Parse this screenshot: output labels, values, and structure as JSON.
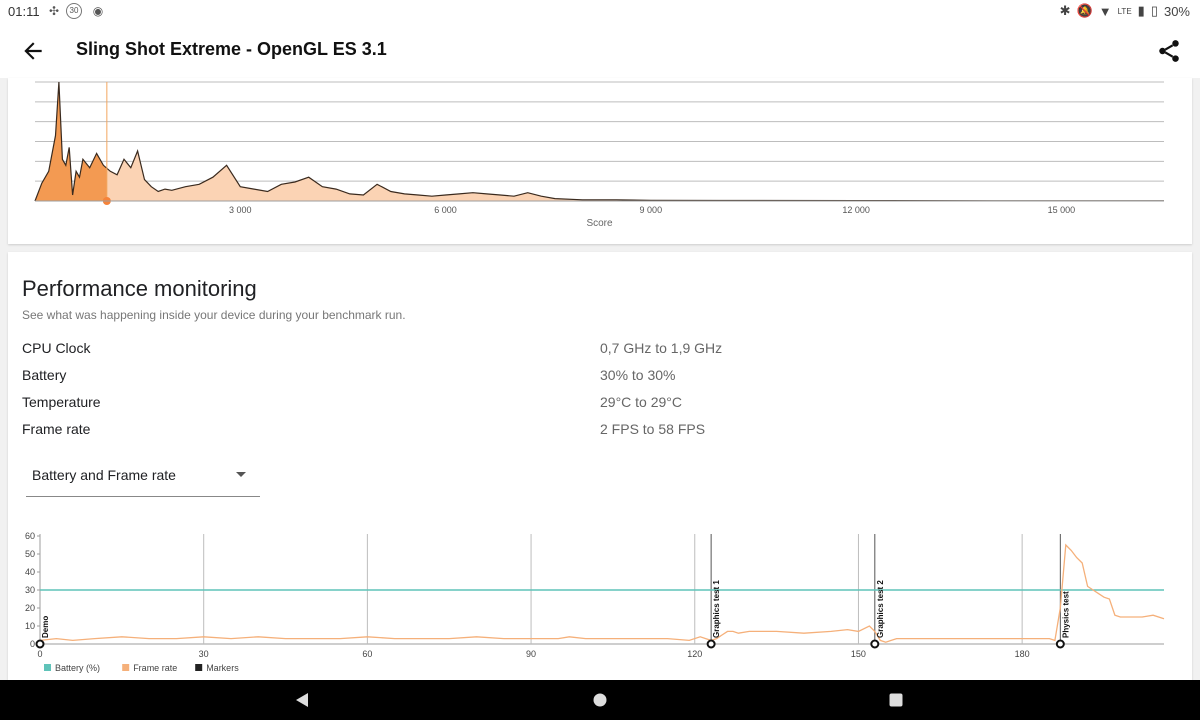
{
  "status": {
    "time": "01:11",
    "badge": "30",
    "network": "LTE",
    "battery": "30%"
  },
  "app_bar": {
    "title": "Sling Shot Extreme - OpenGL ES 3.1",
    "icons": [
      "back-arrow-icon",
      "share-icon"
    ]
  },
  "distribution": {
    "x_axis_label": "Score",
    "ticks": [
      "3 000",
      "6 000",
      "9 000",
      "12 000",
      "15 000"
    ]
  },
  "performance": {
    "title": "Performance monitoring",
    "subtitle": "See what was happening inside your device during your benchmark run.",
    "metrics": [
      {
        "label": "CPU Clock",
        "value": "0,7 GHz to 1,9 GHz"
      },
      {
        "label": "Battery",
        "value": "30% to 30%"
      },
      {
        "label": "Temperature",
        "value": "29°C to 29°C"
      },
      {
        "label": "Frame rate",
        "value": "2 FPS to 58 FPS"
      }
    ],
    "dropdown_value": "Battery and Frame rate"
  },
  "chart_data": [
    {
      "type": "area",
      "xlabel": "Score",
      "ylabel": "",
      "xlim": [
        0,
        16500
      ],
      "x_ticks": [
        3000,
        6000,
        9000,
        12000,
        15000
      ],
      "x_tick_labels": [
        "3 000",
        "6 000",
        "9 000",
        "12 000",
        "15 000"
      ],
      "grid": true,
      "highlight_score": 1050,
      "x": [
        0,
        100,
        200,
        300,
        350,
        400,
        450,
        500,
        550,
        600,
        650,
        700,
        800,
        900,
        1000,
        1100,
        1200,
        1300,
        1400,
        1500,
        1600,
        1700,
        1800,
        1900,
        2000,
        2200,
        2400,
        2600,
        2800,
        3000,
        3200,
        3400,
        3600,
        3800,
        4000,
        4200,
        4400,
        4600,
        4800,
        5000,
        5200,
        5400,
        5600,
        5800,
        6000,
        6200,
        6400,
        6600,
        6800,
        7000,
        7200,
        7400,
        7600,
        8000,
        8500,
        9000,
        10000,
        12000,
        14000,
        16500
      ],
      "values": [
        0,
        15,
        25,
        55,
        100,
        35,
        30,
        45,
        5,
        25,
        20,
        35,
        28,
        40,
        30,
        25,
        22,
        35,
        28,
        42,
        18,
        12,
        8,
        10,
        9,
        12,
        14,
        20,
        30,
        12,
        10,
        8,
        14,
        16,
        20,
        12,
        10,
        6,
        5,
        14,
        8,
        6,
        5,
        4,
        5,
        6,
        7,
        6,
        5,
        4,
        7,
        4,
        2,
        1,
        1,
        0.5,
        0.4,
        0.3,
        0.2,
        0.1
      ]
    },
    {
      "type": "line",
      "xlabel": "",
      "ylabel": "",
      "xlim": [
        0,
        206
      ],
      "ylim": [
        0,
        60
      ],
      "x_ticks": [
        0,
        30,
        60,
        90,
        120,
        150,
        180
      ],
      "y_ticks": [
        0,
        10,
        20,
        30,
        40,
        50,
        60
      ],
      "grid": true,
      "legend": "bottom-left",
      "series": [
        {
          "name": "Battery (%)",
          "x": [
            0,
            206
          ],
          "values": [
            30,
            30
          ]
        },
        {
          "name": "Frame rate",
          "x": [
            0,
            3,
            6,
            10,
            15,
            20,
            25,
            30,
            35,
            40,
            45,
            50,
            55,
            60,
            65,
            70,
            75,
            80,
            85,
            90,
            95,
            97,
            100,
            105,
            110,
            115,
            119,
            121,
            122,
            123,
            124,
            125,
            126,
            127,
            128,
            130,
            135,
            140,
            145,
            148,
            150,
            152,
            153,
            154,
            155,
            156,
            157,
            158,
            160,
            165,
            170,
            175,
            180,
            185,
            186,
            187,
            188,
            189,
            190,
            191,
            192,
            193,
            194,
            195,
            196,
            197,
            198,
            200,
            202,
            204,
            206
          ],
          "values": [
            2,
            3,
            2,
            3,
            4,
            3,
            3,
            4,
            3,
            4,
            3,
            3,
            3,
            4,
            3,
            3,
            3,
            4,
            3,
            3,
            3,
            4,
            3,
            3,
            3,
            3,
            2,
            4,
            3,
            2,
            3,
            5,
            7,
            7,
            6,
            7,
            7,
            6,
            7,
            8,
            7,
            10,
            7,
            2,
            1,
            2,
            3,
            3,
            3,
            3,
            3,
            3,
            3,
            3,
            2,
            20,
            55,
            52,
            48,
            45,
            32,
            30,
            28,
            26,
            25,
            16,
            15,
            15,
            15,
            16,
            14
          ]
        },
        {
          "name": "Markers",
          "x": [
            0,
            123,
            153,
            187
          ],
          "values": [
            0,
            0,
            0,
            0
          ]
        }
      ],
      "markers": [
        {
          "x": 0,
          "label": "Demo"
        },
        {
          "x": 123,
          "label": "Graphics test 1"
        },
        {
          "x": 153,
          "label": "Graphics test 2"
        },
        {
          "x": 187,
          "label": "Physics test"
        }
      ],
      "colors": {
        "battery": "#5fc3b9",
        "frame_rate": "#f5b07a",
        "markers": "#222222"
      }
    }
  ]
}
